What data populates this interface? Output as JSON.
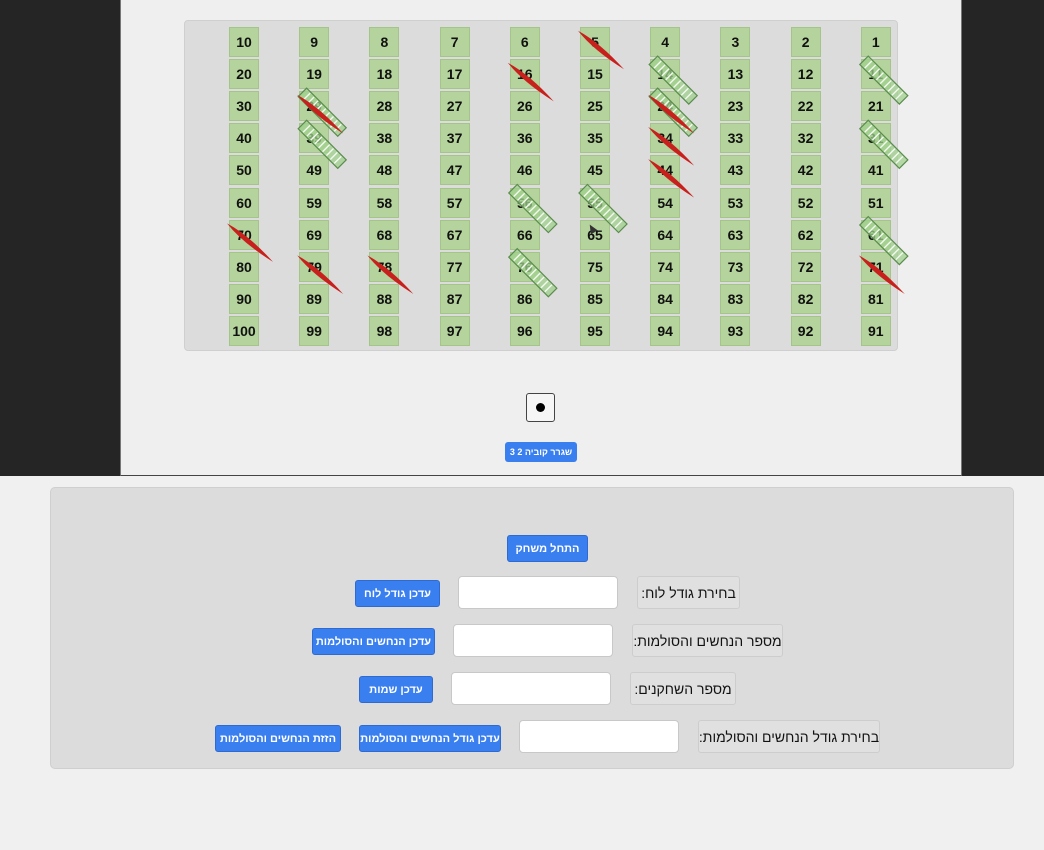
{
  "board": {
    "rows": [
      [
        10,
        9,
        8,
        7,
        6,
        5,
        4,
        3,
        2,
        1
      ],
      [
        20,
        19,
        18,
        17,
        16,
        15,
        14,
        13,
        12,
        11
      ],
      [
        30,
        29,
        28,
        27,
        26,
        25,
        24,
        23,
        22,
        21
      ],
      [
        40,
        39,
        38,
        37,
        36,
        35,
        34,
        33,
        32,
        31
      ],
      [
        50,
        49,
        48,
        47,
        46,
        45,
        44,
        43,
        42,
        41
      ],
      [
        60,
        59,
        58,
        57,
        56,
        55,
        54,
        53,
        52,
        51
      ],
      [
        70,
        69,
        68,
        67,
        66,
        65,
        64,
        63,
        62,
        61
      ],
      [
        80,
        79,
        78,
        77,
        76,
        75,
        74,
        73,
        72,
        71
      ],
      [
        90,
        89,
        88,
        87,
        86,
        85,
        84,
        83,
        82,
        81
      ],
      [
        100,
        99,
        98,
        97,
        96,
        95,
        94,
        93,
        92,
        91
      ]
    ],
    "ladders": [
      {
        "from": 11,
        "to": 11
      },
      {
        "from": 14,
        "to": 14
      },
      {
        "from": 24,
        "to": 24
      },
      {
        "from": 29,
        "to": 29
      },
      {
        "from": 31,
        "to": 31
      },
      {
        "from": 39,
        "to": 39
      },
      {
        "from": 55,
        "to": 55
      },
      {
        "from": 56,
        "to": 56
      },
      {
        "from": 61,
        "to": 61
      },
      {
        "from": 76,
        "to": 76
      }
    ],
    "snakes": [
      {
        "head": 5
      },
      {
        "head": 16
      },
      {
        "head": 24
      },
      {
        "head": 29
      },
      {
        "head": 34
      },
      {
        "head": 44
      },
      {
        "head": 70
      },
      {
        "head": 71
      },
      {
        "head": 79
      },
      {
        "head": 78
      }
    ],
    "colors": {
      "cell": "#b5d39c",
      "snake": "#c8201c",
      "ladder": "#9fd08c",
      "ladder_rail": "#5b8c4e"
    }
  },
  "die": {
    "value": 1
  },
  "roll_button": {
    "label": "3 2 שגרר קוביה"
  },
  "settings": {
    "start_button": "התחל משחק",
    "board_size": {
      "label": "בחירת גודל לוח:",
      "value": "",
      "button": "עדכן גודל לוח"
    },
    "snakes_ladders_count": {
      "label": "מספר הנחשים והסולמות:",
      "value": "",
      "button": "עדכן הנחשים והסולמות"
    },
    "players_count": {
      "label": "מספר השחקנים:",
      "value": "",
      "button": "עדכן שמות"
    },
    "snakes_ladders_size": {
      "label": "בחירת גודל הנחשים והסולמות:",
      "value": "",
      "button": "עדכן גודל הנחשים והסולמות"
    },
    "shift_button": "הזזת הנחשים והסולמות"
  }
}
